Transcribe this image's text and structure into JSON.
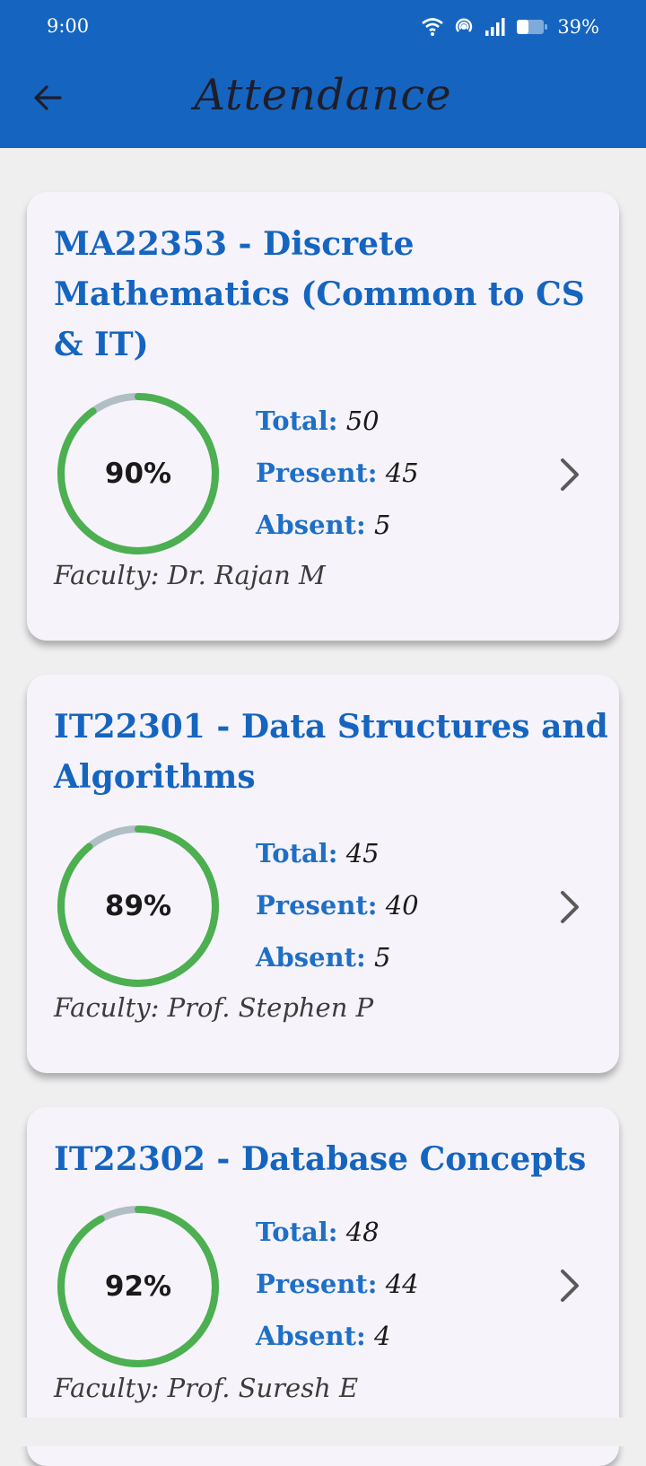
{
  "status_bar": {
    "time": "9:00",
    "battery": "39%"
  },
  "header": {
    "title": "Attendance"
  },
  "labels": {
    "total": "Total:",
    "present": "Present:",
    "absent": "Absent:"
  },
  "colors": {
    "primary": "#1565c0",
    "ring_progress": "#4caf50",
    "ring_track": "#b0bec5"
  },
  "courses": [
    {
      "title": "MA22353 - Discrete Mathematics (Common to CS & IT)",
      "percent_label": "90%",
      "percent": 0.9,
      "total": "50",
      "present": "45",
      "absent": "5",
      "faculty": "Faculty: Dr. Rajan M"
    },
    {
      "title": "IT22301 - Data Structures and Algorithms",
      "percent_label": "89%",
      "percent": 0.89,
      "total": "45",
      "present": "40",
      "absent": "5",
      "faculty": "Faculty: Prof. Stephen P"
    },
    {
      "title": "IT22302 - Database Concepts",
      "percent_label": "92%",
      "percent": 0.92,
      "total": "48",
      "present": "44",
      "absent": "4",
      "faculty": "Faculty: Prof. Suresh E"
    }
  ]
}
